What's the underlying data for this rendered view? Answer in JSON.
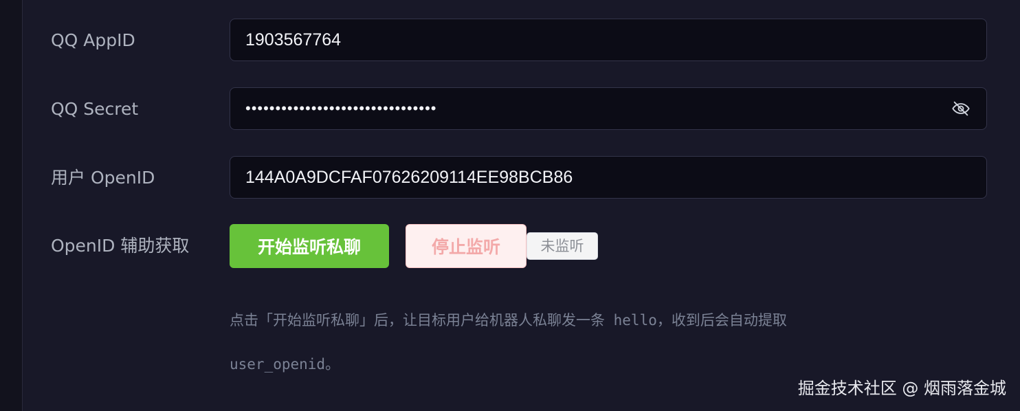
{
  "form": {
    "appid": {
      "label": "QQ AppID",
      "value": "1903567764"
    },
    "secret": {
      "label": "QQ Secret",
      "value": "••••••••••••••••••••••••••••••••"
    },
    "openid": {
      "label": "用户 OpenID",
      "value": "144A0A9DCFAF07626209114EE98BCB86"
    },
    "assist": {
      "label": "OpenID 辅助获取",
      "start_label": "开始监听私聊",
      "stop_label": "停止监听",
      "status": "未监听"
    },
    "hint": "点击「开始监听私聊」后，让目标用户给机器人私聊发一条 hello，收到后会自动提取 user_openid。"
  },
  "icons": {
    "toggle_visibility": "eye-off-icon"
  },
  "colors": {
    "start_button": "#67c23a",
    "stop_button_bg": "#fef0f0",
    "stop_button_text": "#f3a9a9"
  },
  "watermark": "掘金技术社区 @ 烟雨落金城"
}
